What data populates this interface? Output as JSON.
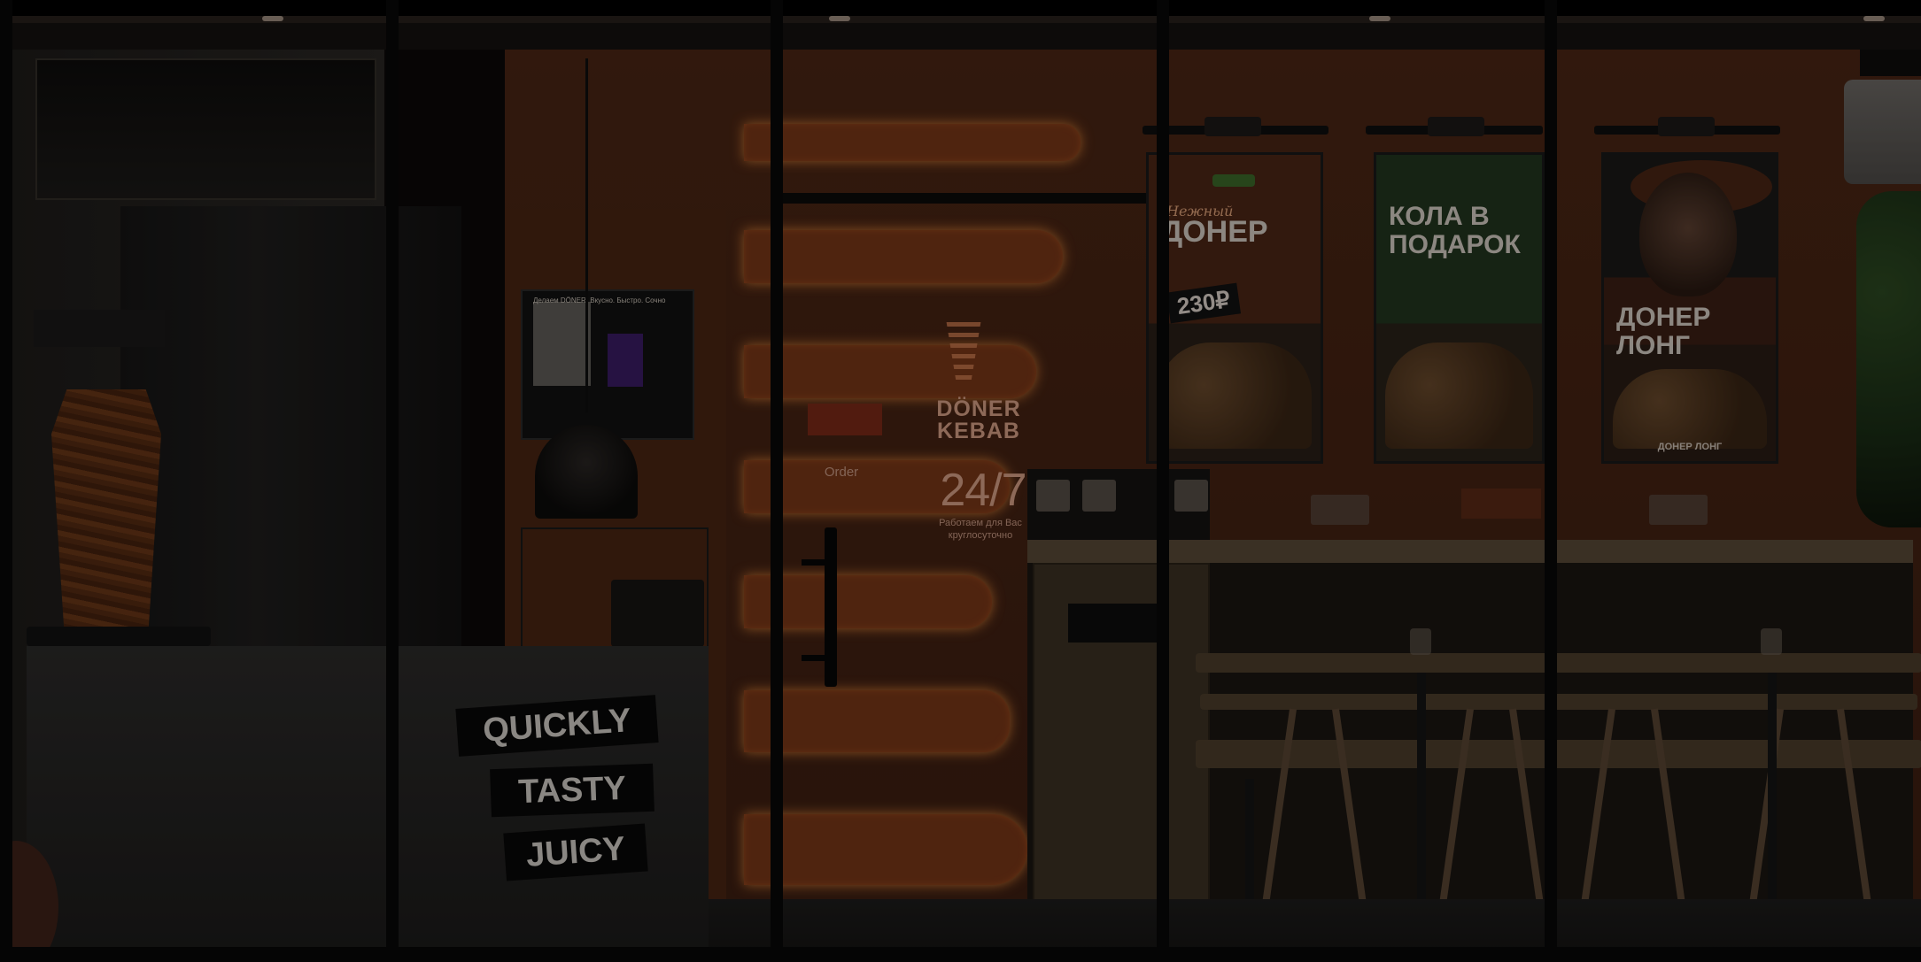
{
  "sticker": {
    "line1": "QUICKLY",
    "line2": "TASTY",
    "line3": "JUICY"
  },
  "logo": {
    "brand": "DÖNER KEBAB",
    "hours": "24/7",
    "hours_caption": "Работаем для Вас круглосуточно",
    "side_label": "Order"
  },
  "menu_board": {
    "note": "Делаем DÖNER. Вкусно. Быстро. Сочно"
  },
  "posters": [
    {
      "script": "Нежный",
      "headline": "ДОНЕР",
      "price": "230₽"
    },
    {
      "headline": "КОЛА В ПОДАРОК"
    },
    {
      "headline": "ДОНЕР ЛОНГ",
      "caption": "ДОНЕР ЛОНГ"
    }
  ],
  "colors": {
    "orange_wall": "#4c2614",
    "glow": "#d27b36",
    "sticker_bg": "#080808",
    "frame": "#050505"
  }
}
